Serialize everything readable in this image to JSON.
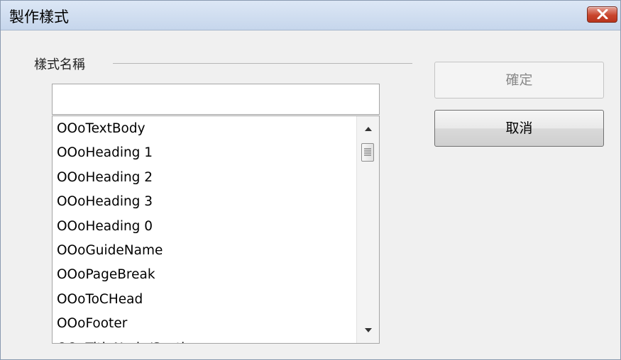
{
  "window": {
    "title": "製作樣式",
    "close_icon": "close-icon"
  },
  "form": {
    "group_label": "樣式名稱",
    "name_input": {
      "value": "",
      "placeholder": ""
    },
    "style_list": {
      "items": [
        "OOoTextBody",
        "OOoHeading 1",
        "OOoHeading 2",
        "OOoHeading 3",
        "OOoHeading 0",
        "OOoGuideName",
        "OOoPageBreak",
        "OOoToCHead",
        "OOoFooter",
        "OOoTitleNode/Section"
      ]
    }
  },
  "buttons": {
    "ok_label": "確定",
    "ok_enabled": false,
    "cancel_label": "取消"
  },
  "colors": {
    "titlebar": "#c6d6ec",
    "close_button": "#c9452d",
    "dialog_bg": "#f0f0f0"
  }
}
